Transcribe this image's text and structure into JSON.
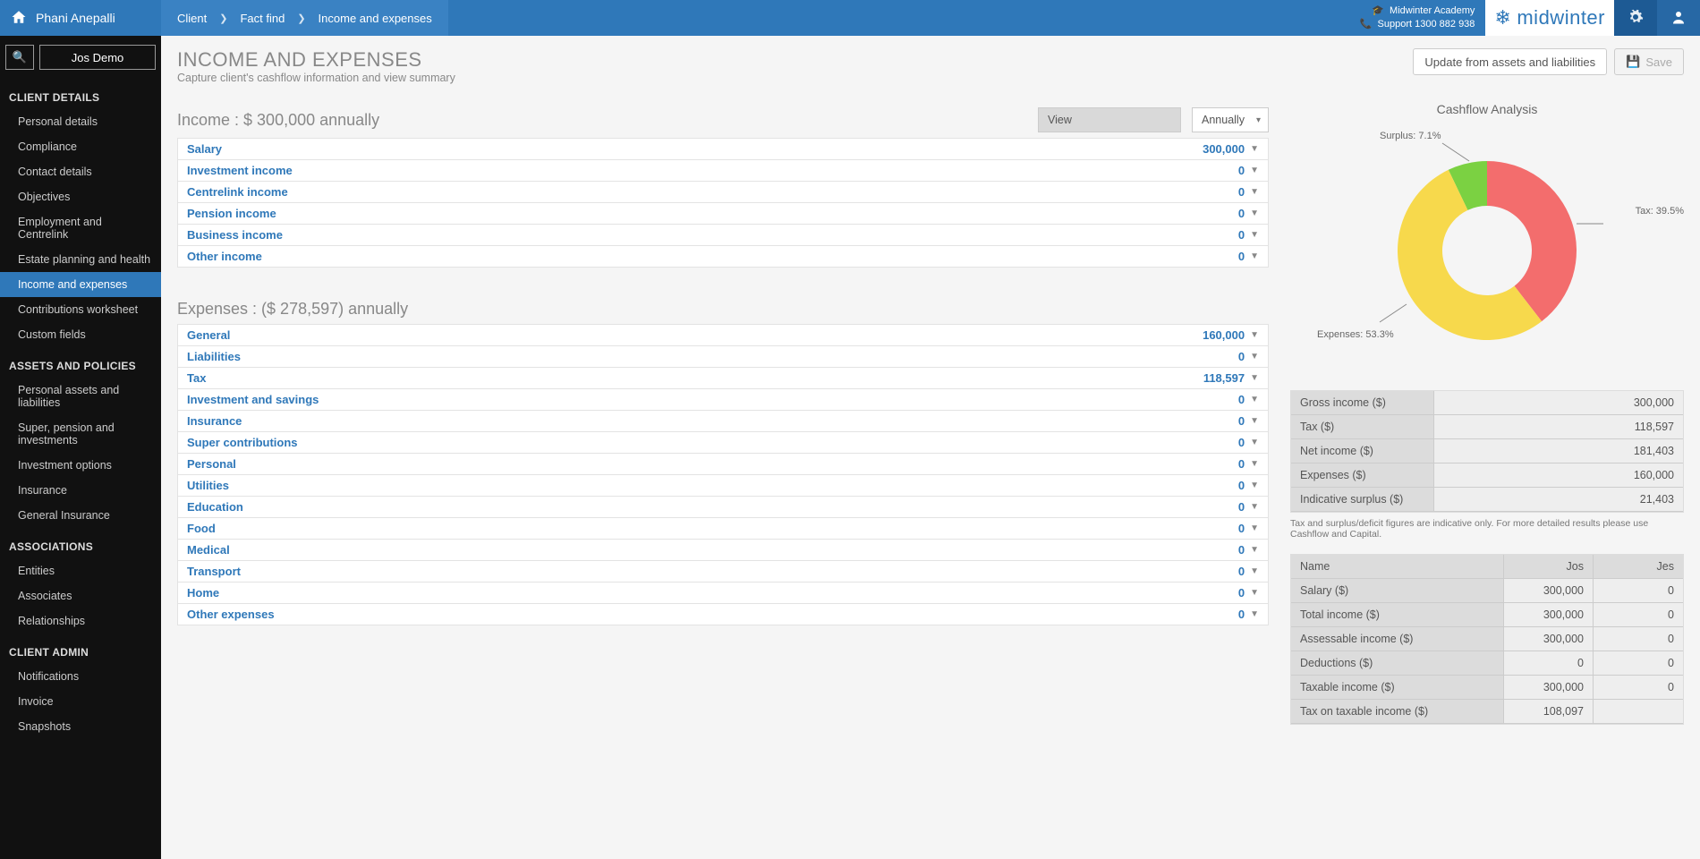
{
  "topbar": {
    "user_name": "Phani Anepalli",
    "breadcrumbs": [
      "Client",
      "Fact find",
      "Income and expenses"
    ],
    "academy_label": "Midwinter Academy",
    "support_label": "Support 1300 882 938",
    "brand": "midwinter"
  },
  "sidebar": {
    "client_button": "Jos Demo",
    "groups": [
      {
        "title": "CLIENT DETAILS",
        "items": [
          "Personal details",
          "Compliance",
          "Contact details",
          "Objectives",
          "Employment and Centrelink",
          "Estate planning and health",
          "Income and expenses",
          "Contributions worksheet",
          "Custom fields"
        ],
        "active_index": 6
      },
      {
        "title": "ASSETS AND POLICIES",
        "items": [
          "Personal assets and liabilities",
          "Super, pension and investments",
          "Investment options",
          "Insurance",
          "General Insurance"
        ]
      },
      {
        "title": "ASSOCIATIONS",
        "items": [
          "Entities",
          "Associates",
          "Relationships"
        ]
      },
      {
        "title": "CLIENT ADMIN",
        "items": [
          "Notifications",
          "Invoice",
          "Snapshots"
        ]
      }
    ]
  },
  "page": {
    "title": "INCOME AND EXPENSES",
    "subtitle": "Capture client's cashflow information and view summary",
    "btn_update": "Update from assets and liabilities",
    "btn_save": "Save"
  },
  "income": {
    "heading": "Income : $ 300,000 annually",
    "view_label": "View",
    "period_label": "Annually",
    "rows": [
      {
        "label": "Salary",
        "value": "300,000"
      },
      {
        "label": "Investment income",
        "value": "0"
      },
      {
        "label": "Centrelink income",
        "value": "0"
      },
      {
        "label": "Pension income",
        "value": "0"
      },
      {
        "label": "Business income",
        "value": "0"
      },
      {
        "label": "Other income",
        "value": "0"
      }
    ]
  },
  "expenses": {
    "heading": "Expenses : ($ 278,597) annually",
    "rows": [
      {
        "label": "General",
        "value": "160,000"
      },
      {
        "label": "Liabilities",
        "value": "0"
      },
      {
        "label": "Tax",
        "value": "118,597"
      },
      {
        "label": "Investment and savings",
        "value": "0"
      },
      {
        "label": "Insurance",
        "value": "0"
      },
      {
        "label": "Super contributions",
        "value": "0"
      },
      {
        "label": "Personal",
        "value": "0"
      },
      {
        "label": "Utilities",
        "value": "0"
      },
      {
        "label": "Education",
        "value": "0"
      },
      {
        "label": "Food",
        "value": "0"
      },
      {
        "label": "Medical",
        "value": "0"
      },
      {
        "label": "Transport",
        "value": "0"
      },
      {
        "label": "Home",
        "value": "0"
      },
      {
        "label": "Other expenses",
        "value": "0"
      }
    ]
  },
  "chart": {
    "title": "Cashflow Analysis",
    "labels": {
      "surplus": "Surplus: 7.1%",
      "tax": "Tax: 39.5%",
      "expenses": "Expenses: 53.3%"
    }
  },
  "chart_data": {
    "type": "pie",
    "title": "Cashflow Analysis",
    "series": [
      {
        "name": "Surplus",
        "value": 7.1,
        "color": "#7bd142"
      },
      {
        "name": "Tax",
        "value": 39.5,
        "color": "#f36d6d"
      },
      {
        "name": "Expenses",
        "value": 53.3,
        "color": "#f7d94c"
      }
    ]
  },
  "summary": {
    "rows": [
      {
        "k": "Gross income ($)",
        "v": "300,000"
      },
      {
        "k": "Tax ($)",
        "v": "118,597"
      },
      {
        "k": "Net income ($)",
        "v": "181,403"
      },
      {
        "k": "Expenses ($)",
        "v": "160,000"
      },
      {
        "k": "Indicative surplus ($)",
        "v": "21,403"
      }
    ],
    "note": "Tax and surplus/deficit figures are indicative only. For more detailed results please use Cashflow and Capital."
  },
  "table2": {
    "headers": [
      "Name",
      "Jos",
      "Jes"
    ],
    "rows": [
      {
        "c1": "Salary ($)",
        "c2": "300,000",
        "c3": "0"
      },
      {
        "c1": "Total income ($)",
        "c2": "300,000",
        "c3": "0"
      },
      {
        "c1": "Assessable income ($)",
        "c2": "300,000",
        "c3": "0"
      },
      {
        "c1": "Deductions ($)",
        "c2": "0",
        "c3": "0"
      },
      {
        "c1": "Taxable income ($)",
        "c2": "300,000",
        "c3": "0"
      },
      {
        "c1": "Tax on taxable income ($)",
        "c2": "108,097",
        "c3": ""
      }
    ]
  }
}
